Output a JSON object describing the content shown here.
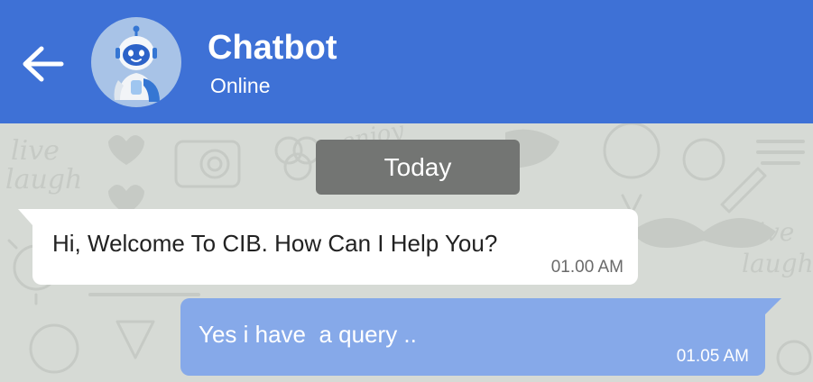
{
  "header": {
    "title": "Chatbot",
    "status": "Online",
    "background_color": "#3e71d6",
    "back_icon": "arrow-left-icon",
    "avatar_icon": "robot-icon"
  },
  "chat": {
    "date_divider": "Today",
    "messages": [
      {
        "direction": "incoming",
        "text": "Hi, Welcome To CIB. How Can I Help You?",
        "time": "01.00 AM",
        "bubble_color": "#ffffff"
      },
      {
        "direction": "outgoing",
        "text": "Yes i have  a query ..",
        "time": "01.05 AM",
        "bubble_color": "#86a9e9"
      }
    ]
  }
}
